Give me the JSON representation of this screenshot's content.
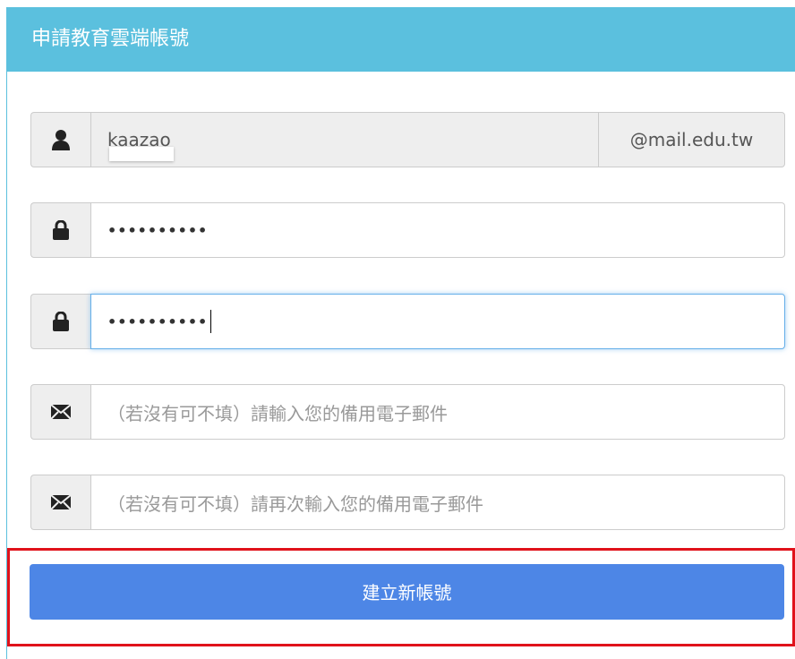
{
  "panel": {
    "title": "申請教育雲端帳號"
  },
  "username": {
    "icon": "user-icon",
    "value": "kaazao",
    "domain_suffix": "@mail.edu.tw"
  },
  "password": {
    "icon": "lock-icon",
    "masked_value": "••••••••••"
  },
  "password_confirm": {
    "icon": "lock-icon",
    "masked_value": "••••••••••"
  },
  "backup_email": {
    "icon": "envelope-icon",
    "placeholder": "（若沒有可不填）請輸入您的備用電子郵件"
  },
  "backup_email_confirm": {
    "icon": "envelope-icon",
    "placeholder": "（若沒有可不填）請再次輸入您的備用電子郵件"
  },
  "submit": {
    "label": "建立新帳號"
  },
  "colors": {
    "header": "#5bc0de",
    "button": "#4d86e6",
    "highlight": "#e0121b"
  }
}
